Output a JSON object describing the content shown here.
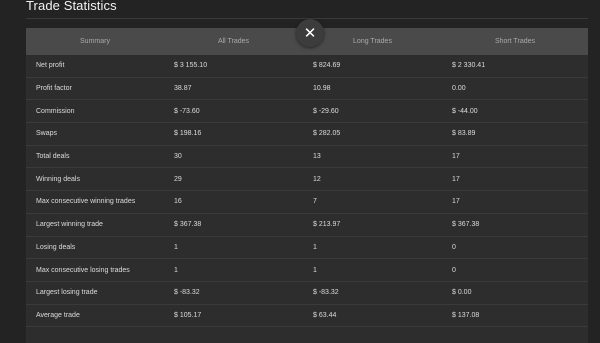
{
  "title": "Trade Statistics",
  "columns": [
    "Summary",
    "All Trades",
    "Long Trades",
    "Short Trades"
  ],
  "rows": [
    [
      "Net profit",
      "$ 3 155.10",
      "$ 824.69",
      "$ 2 330.41"
    ],
    [
      "Profit factor",
      "38.87",
      "10.98",
      "0.00"
    ],
    [
      "Commission",
      "$ -73.60",
      "$ -29.60",
      "$ -44.00"
    ],
    [
      "Swaps",
      "$ 198.16",
      "$ 282.05",
      "$ 83.89"
    ],
    [
      "Total deals",
      "30",
      "13",
      "17"
    ],
    [
      "Winning deals",
      "29",
      "12",
      "17"
    ],
    [
      "Max consecutive winning trades",
      "16",
      "7",
      "17"
    ],
    [
      "Largest winning trade",
      "$ 367.38",
      "$ 213.97",
      "$ 367.38"
    ],
    [
      "Losing deals",
      "1",
      "1",
      "0"
    ],
    [
      "Max consecutive losing trades",
      "1",
      "1",
      "0"
    ],
    [
      "Largest losing trade",
      "$ -83.32",
      "$ -83.32",
      "$ 0.00"
    ],
    [
      "Average trade",
      "$ 105.17",
      "$ 63.44",
      "$ 137.08"
    ]
  ],
  "close_icon": "✕"
}
